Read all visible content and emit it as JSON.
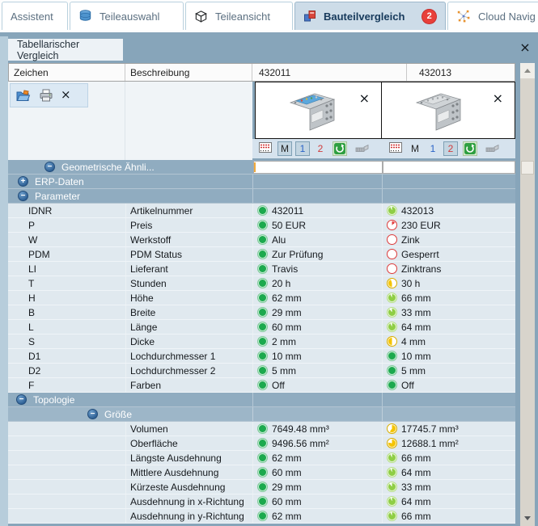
{
  "tabs": [
    {
      "label": "Assistent",
      "active": false
    },
    {
      "label": "Teileauswahl",
      "active": false
    },
    {
      "label": "Teileansicht",
      "active": false
    },
    {
      "label": "Bauteilvergleich",
      "active": true,
      "badge": "2"
    },
    {
      "label": "Cloud Navig",
      "active": false
    }
  ],
  "panel": {
    "tab_label": "Tabellarischer Vergleich"
  },
  "table": {
    "headers": [
      "Zeichen",
      "Beschreibung",
      "432011",
      "432013"
    ]
  },
  "toolbar_labels": {
    "m": "M",
    "one": "1",
    "two": "2"
  },
  "columns": [
    {
      "id": "432011",
      "m_selected": true,
      "one_selected": true,
      "two_selected": false
    },
    {
      "id": "432013",
      "m_selected": false,
      "one_selected": false,
      "two_selected": true
    }
  ],
  "icons": {
    "minus": "−",
    "plus": "+",
    "close": "×"
  },
  "colors": {
    "green": "#1CA94E",
    "lightgreen": "#8FCE45",
    "yellow": "#F4C400",
    "red": "#E23C3C",
    "section": "#90ACC0",
    "section_light": "#9DB6C8",
    "accent_band": "#87A5BA",
    "badge": "#E8403A"
  },
  "rows": [
    {
      "type": "section",
      "label": "Geometrische Ähnli...",
      "toggle": "minus",
      "indent": 45,
      "variant": "geo"
    },
    {
      "type": "section",
      "label": "ERP-Daten",
      "toggle": "plus",
      "indent": 12
    },
    {
      "type": "section",
      "label": "Parameter",
      "toggle": "minus",
      "indent": 12
    },
    {
      "type": "data",
      "z": "IDNR",
      "d": "Artikelnummer",
      "v1": {
        "t": "432011",
        "c": "green",
        "f": 1
      },
      "v2": {
        "t": "432013",
        "c": "lightgreen",
        "f": 0.93
      }
    },
    {
      "type": "data",
      "z": "P",
      "d": "Preis",
      "v1": {
        "t": "50 EUR",
        "c": "green",
        "f": 1
      },
      "v2": {
        "t": "230 EUR",
        "c": "red",
        "f": 0.15
      }
    },
    {
      "type": "data",
      "z": "W",
      "d": "Werkstoff",
      "v1": {
        "t": "Alu",
        "c": "green",
        "f": 1
      },
      "v2": {
        "t": "Zink",
        "c": "red",
        "f": 0
      }
    },
    {
      "type": "data",
      "z": "PDM",
      "d": "PDM Status",
      "v1": {
        "t": "Zur Prüfung",
        "c": "green",
        "f": 1
      },
      "v2": {
        "t": "Gesperrt",
        "c": "red",
        "f": 0
      }
    },
    {
      "type": "data",
      "z": "LI",
      "d": "Lieferant",
      "v1": {
        "t": "Travis",
        "c": "green",
        "f": 1
      },
      "v2": {
        "t": "Zinktrans",
        "c": "red",
        "f": 0
      }
    },
    {
      "type": "data",
      "z": "T",
      "d": "Stunden",
      "v1": {
        "t": "20 h",
        "c": "green",
        "f": 1
      },
      "v2": {
        "t": "30 h",
        "c": "yellow",
        "f": 0.45,
        "dir": "b"
      }
    },
    {
      "type": "data",
      "z": "H",
      "d": "Höhe",
      "v1": {
        "t": "62 mm",
        "c": "green",
        "f": 1
      },
      "v2": {
        "t": "66 mm",
        "c": "lightgreen",
        "f": 0.93
      }
    },
    {
      "type": "data",
      "z": "B",
      "d": "Breite",
      "v1": {
        "t": "29 mm",
        "c": "green",
        "f": 1
      },
      "v2": {
        "t": "33 mm",
        "c": "lightgreen",
        "f": 0.9
      }
    },
    {
      "type": "data",
      "z": "L",
      "d": "Länge",
      "v1": {
        "t": "60 mm",
        "c": "green",
        "f": 1
      },
      "v2": {
        "t": "64 mm",
        "c": "lightgreen",
        "f": 0.93
      }
    },
    {
      "type": "data",
      "z": "S",
      "d": "Dicke",
      "v1": {
        "t": "2 mm",
        "c": "green",
        "f": 1
      },
      "v2": {
        "t": "4 mm",
        "c": "yellow",
        "f": 0.5,
        "dir": "b"
      }
    },
    {
      "type": "data",
      "z": "D1",
      "d": "Lochdurchmesser 1",
      "v1": {
        "t": "10 mm",
        "c": "green",
        "f": 1
      },
      "v2": {
        "t": "10 mm",
        "c": "green",
        "f": 1
      }
    },
    {
      "type": "data",
      "z": "D2",
      "d": "Lochdurchmesser 2",
      "v1": {
        "t": "5 mm",
        "c": "green",
        "f": 1
      },
      "v2": {
        "t": "5 mm",
        "c": "green",
        "f": 1
      }
    },
    {
      "type": "data",
      "z": "F",
      "d": "Farben",
      "v1": {
        "t": "Off",
        "c": "green",
        "f": 1
      },
      "v2": {
        "t": "Off",
        "c": "green",
        "f": 1
      }
    },
    {
      "type": "section",
      "label": "Topologie",
      "toggle": "minus",
      "indent": 10
    },
    {
      "type": "section",
      "label": "Größe",
      "toggle": "minus",
      "indent": 98,
      "variant": "light"
    },
    {
      "type": "data",
      "z": "",
      "d": "Volumen",
      "v1": {
        "t": "7649.48 mm³",
        "c": "green",
        "f": 1
      },
      "v2": {
        "t": "17745.7 mm³",
        "c": "yellow",
        "f": 0.6
      }
    },
    {
      "type": "data",
      "z": "",
      "d": "Oberfläche",
      "v1": {
        "t": "9496.56 mm²",
        "c": "green",
        "f": 1
      },
      "v2": {
        "t": "12688.1 mm²",
        "c": "yellow",
        "f": 0.78
      }
    },
    {
      "type": "data",
      "z": "",
      "d": "Längste Ausdehnung",
      "v1": {
        "t": "62 mm",
        "c": "green",
        "f": 1
      },
      "v2": {
        "t": "66 mm",
        "c": "lightgreen",
        "f": 0.93
      }
    },
    {
      "type": "data",
      "z": "",
      "d": "Mittlere Ausdehnung",
      "v1": {
        "t": "60 mm",
        "c": "green",
        "f": 1
      },
      "v2": {
        "t": "64 mm",
        "c": "lightgreen",
        "f": 0.93
      }
    },
    {
      "type": "data",
      "z": "",
      "d": "Kürzeste Ausdehnung",
      "v1": {
        "t": "29 mm",
        "c": "green",
        "f": 1
      },
      "v2": {
        "t": "33 mm",
        "c": "lightgreen",
        "f": 0.9
      }
    },
    {
      "type": "data",
      "z": "",
      "d": "Ausdehnung in x-Richtung",
      "v1": {
        "t": "60 mm",
        "c": "green",
        "f": 1
      },
      "v2": {
        "t": "64 mm",
        "c": "lightgreen",
        "f": 0.93
      }
    },
    {
      "type": "data",
      "z": "",
      "d": "Ausdehnung in y-Richtung",
      "v1": {
        "t": "62 mm",
        "c": "green",
        "f": 1
      },
      "v2": {
        "t": "66 mm",
        "c": "lightgreen",
        "f": 0.93
      }
    }
  ]
}
